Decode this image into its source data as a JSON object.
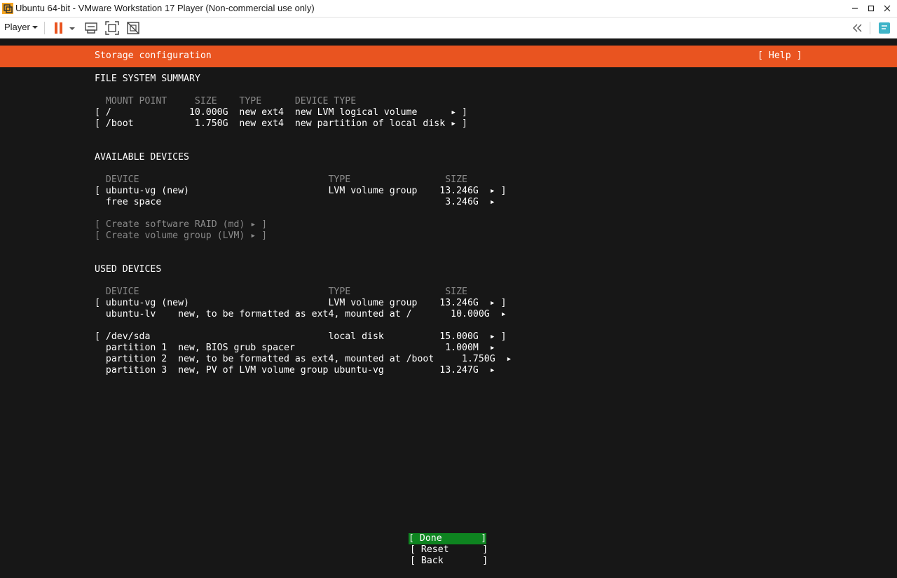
{
  "window": {
    "title": "Ubuntu 64-bit - VMware Workstation 17 Player (Non-commercial use only)",
    "controls": [
      "minimize-icon",
      "maximize-icon",
      "close-icon"
    ]
  },
  "toolbar": {
    "player_menu": "Player",
    "icons": [
      "pause-icon",
      "send-ctrl-alt-del-icon",
      "fullscreen-icon",
      "unity-icon",
      "collapse-icon",
      "message-icon"
    ]
  },
  "installer": {
    "header_title": "Storage configuration",
    "help": "[ Help ]",
    "fs_summary": {
      "title": "FILE SYSTEM SUMMARY",
      "columns": "  MOUNT POINT     SIZE    TYPE      DEVICE TYPE",
      "rows": [
        "[ /              10.000G  new ext4  new LVM logical volume      ▸ ]",
        "[ /boot           1.750G  new ext4  new partition of local disk ▸ ]"
      ]
    },
    "available": {
      "title": "AVAILABLE DEVICES",
      "columns": "  DEVICE                                  TYPE                 SIZE",
      "rows": [
        "[ ubuntu-vg (new)                         LVM volume group    13.246G  ▸ ]",
        "  free space                                                   3.246G  ▸"
      ],
      "actions": [
        "[ Create software RAID (md) ▸ ]",
        "[ Create volume group (LVM) ▸ ]"
      ]
    },
    "used": {
      "title": "USED DEVICES",
      "columns": "  DEVICE                                  TYPE                 SIZE",
      "rows": [
        "[ ubuntu-vg (new)                         LVM volume group    13.246G  ▸ ]",
        "  ubuntu-lv    new, to be formatted as ext4, mounted at /       10.000G  ▸",
        "[ /dev/sda                                local disk          15.000G  ▸ ]",
        "  partition 1  new, BIOS grub spacer                           1.000M  ▸",
        "  partition 2  new, to be formatted as ext4, mounted at /boot     1.750G  ▸",
        "  partition 3  new, PV of LVM volume group ubuntu-vg          13.247G  ▸"
      ]
    },
    "buttons": {
      "done": "[ Done       ]",
      "reset": "[ Reset      ]",
      "back": "[ Back       ]"
    }
  },
  "colors": {
    "accent": "#e95420",
    "selected_button": "#0e8420",
    "background": "#171717"
  }
}
